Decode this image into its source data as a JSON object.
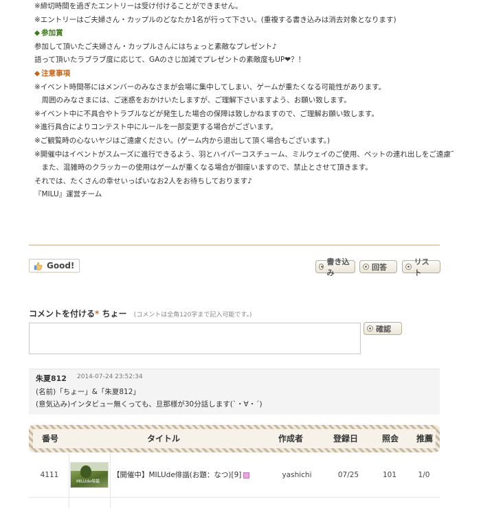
{
  "body": {
    "lines": [
      {
        "text": "※締切時間を過ぎたエントリーは受け付けることができません。",
        "style": "normal"
      },
      {
        "text": "※エントリーはご夫婦さん・カップルのどなたか1名が行って下さい。(重複する書き込みは消去対象となります)",
        "style": "normal"
      },
      {
        "text": "参加賞",
        "style": "heading-green"
      },
      {
        "text": "参加して頂いたご夫婦さん・カップルさんにはちょっと素敵なプレゼント♪",
        "style": "normal"
      },
      {
        "text": "語って頂いたラブラブ度に応じて、GAのさじ加減でプレゼントの素敵度もUP❤？！",
        "style": "normal"
      },
      {
        "text": "注意事項",
        "style": "heading-orange"
      },
      {
        "text": "※イベント時間帯にはメンバーのみなさまが会場に集中してしまい、ゲームが重たくなる可能性があります。",
        "style": "normal"
      },
      {
        "text": "　周囲のみなさまには、ご迷惑をおかけいたしますが、ご理解下さいますよう、お願い致します。",
        "style": "normal"
      },
      {
        "text": "※イベント中に不具合やトラブルなどが発生した場合の保障は致しかねますので、ご理解お願い致します。",
        "style": "normal"
      },
      {
        "text": "※進行具合によりコンテスト中にルールを一部変更する場合がございます。",
        "style": "normal"
      },
      {
        "text": "※ご観覧時の心ないヤジはご遠慮ください。(ゲーム内から退出して頂く場合もございます。)",
        "style": "normal"
      },
      {
        "text": "※開催中はイベントがスムーズに進行できるよう、羽とハイパーコスチューム、ミルウェイのご使用、ペットの連れ出しをご遠慮下さい。",
        "style": "normal"
      },
      {
        "text": "　また、混雑時のクラッカーの使用はゲームが重くなる場合が御座いますので、禁止とさせて頂きます。",
        "style": "normal"
      },
      {
        "text": "それでは、たくさんの幸せいっぱいなお2人をお待ちしております♪",
        "style": "normal"
      },
      {
        "text": "『MILU』運営チーム",
        "style": "normal"
      }
    ]
  },
  "actions": {
    "good_label": "Good!",
    "write_label": "書き込み",
    "reply_label": "回答",
    "list_label": "リスト"
  },
  "comment_form": {
    "title": "コメントを付ける",
    "required_mark": "*",
    "user": "ちょー",
    "hint": "(コメントは全角120字まで記入可能です。)",
    "confirm_label": "確認"
  },
  "comment": {
    "author": "朱夏812",
    "time": "2014-07-24 23:52:34",
    "line1": "(名前)「ちょー」&「朱夏812」",
    "line2": "(意気込み)インタビュー無くっても、旦那様が30分話します(`・∀・´)"
  },
  "table": {
    "headers": {
      "number": "番号",
      "title": "タイトル",
      "author": "作成者",
      "date": "登録日",
      "views": "照会",
      "recommend": "推薦"
    },
    "rows": [
      {
        "number": "4111",
        "title": "【開催中】MILUde俳諧(お題：なつ)",
        "comments": "[9]",
        "author": "yashichi",
        "date": "07/25",
        "views": "101",
        "recommend": "1/0",
        "thumb_text": "MILUde俳諧"
      }
    ]
  },
  "colors": {
    "accent_green": "#3d7a1a",
    "accent_orange": "#c8651a",
    "divider": "#e2d2b0"
  }
}
